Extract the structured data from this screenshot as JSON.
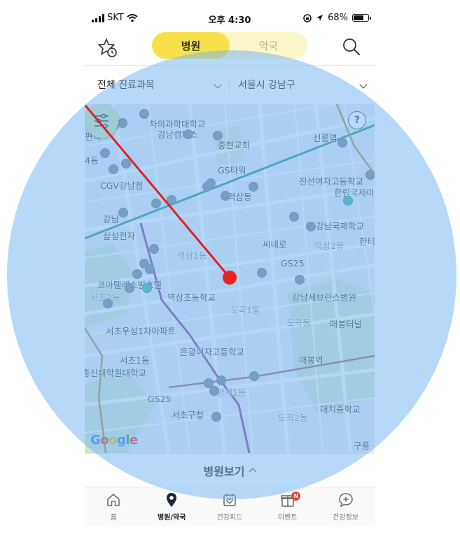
{
  "status_bar": {
    "carrier": "SKT",
    "time": "오후 4:30",
    "battery": "68%"
  },
  "header": {
    "tabs": [
      {
        "label": "병원",
        "active": true
      },
      {
        "label": "약국",
        "active": false
      }
    ],
    "icons": {
      "favorite": "star-clock-icon",
      "search": "search-icon"
    }
  },
  "filters": {
    "department": "전체 진료과목",
    "region": "서울시 강남구"
  },
  "map": {
    "labels": [
      {
        "text": "차의과학대학교"
      },
      {
        "text": "강남캠퍼스"
      },
      {
        "text": "충현교회"
      },
      {
        "text": "선릉역"
      },
      {
        "text": "GS타워"
      },
      {
        "text": "진선여자고등학교"
      },
      {
        "text": "한림국제미"
      },
      {
        "text": "역삼동"
      },
      {
        "text": "CGV강남점"
      },
      {
        "text": "강남국제학교"
      },
      {
        "text": "강남"
      },
      {
        "text": "삼성전자"
      },
      {
        "text": "씨네로"
      },
      {
        "text": "역삼2동"
      },
      {
        "text": "한티"
      },
      {
        "text": "역삼1동"
      },
      {
        "text": "GS25"
      },
      {
        "text": "코아텔레스빌호텔"
      },
      {
        "text": "역삼초등학교"
      },
      {
        "text": "강남세브란스병원"
      },
      {
        "text": "서초2동"
      },
      {
        "text": "도곡1동"
      },
      {
        "text": "도곡동"
      },
      {
        "text": "매봉터널"
      },
      {
        "text": "서초우성1차아파트"
      },
      {
        "text": "은광여자고등학교"
      },
      {
        "text": "서초1동"
      },
      {
        "text": "매봉역"
      },
      {
        "text": "총신대학원대학교"
      },
      {
        "text": "GS25"
      },
      {
        "text": "서초구청"
      },
      {
        "text": "도곡2동"
      },
      {
        "text": "대치중학교"
      },
      {
        "text": "구룡"
      },
      {
        "text": "편역"
      },
      {
        "text": "4동"
      },
      {
        "text": "양재1동"
      }
    ],
    "help": "?",
    "google": "Google"
  },
  "sheet": {
    "label": "병원보기"
  },
  "tabbar": {
    "items": [
      {
        "label": "홈",
        "icon": "home-icon"
      },
      {
        "label": "병원/약국",
        "icon": "location-pin-icon",
        "active": true
      },
      {
        "label": "건강피드",
        "icon": "heart-feed-icon"
      },
      {
        "label": "이벤트",
        "icon": "gift-icon",
        "badge": "N"
      },
      {
        "label": "건강정보",
        "icon": "plus-chat-icon"
      }
    ]
  },
  "colors": {
    "accent": "#f8e04a",
    "overlay_circle": "#6eb4f5",
    "annotation_line": "#e02020",
    "teal_pin": "#3fb6a8",
    "gray_pin": "#7f8a98"
  }
}
